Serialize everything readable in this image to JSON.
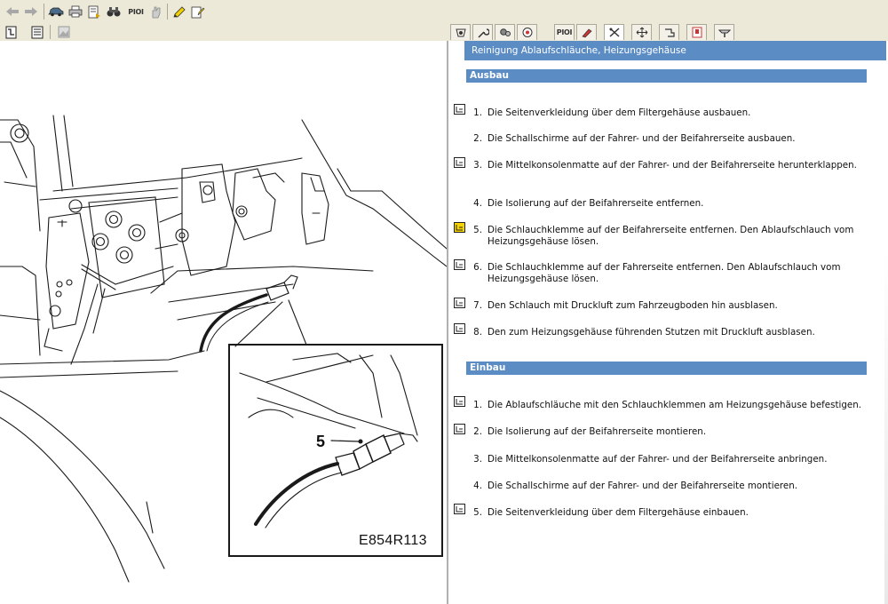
{
  "toolbar": {
    "pioi_label": "PIOI"
  },
  "tabs": {
    "pioi_label": "PIOI"
  },
  "illustration": {
    "callout_number": "5",
    "figure_code": "E854R113"
  },
  "document": {
    "title": "Reinigung Ablaufschläuche, Heizungsgehäuse",
    "sections": [
      {
        "heading": "Ausbau",
        "steps": [
          {
            "num": "1.",
            "text": "Die Seitenverkleidung über dem Filtergehäuse ausbauen."
          },
          {
            "num": "2.",
            "text": "Die Schallschirme auf der Fahrer- und der Beifahrerseite ausbauen."
          },
          {
            "num": "3.",
            "text": "Die Mittelkonsolenmatte auf der Fahrer- und der Beifahrerseite herunterklappen."
          },
          {
            "num": "4.",
            "text": "Die Isolierung auf der Beifahrerseite entfernen."
          },
          {
            "num": "5.",
            "text": "Die Schlauchklemme auf der Beifahrerseite entfernen. Den Ablaufschlauch vom Heizungsgehäuse lösen."
          },
          {
            "num": "6.",
            "text": "Die Schlauchklemme auf der Fahrerseite entfernen. Den Ablaufschlauch vom Heizungsgehäuse lösen."
          },
          {
            "num": "7.",
            "text": "Den Schlauch mit Druckluft zum Fahrzeugboden hin ausblasen."
          },
          {
            "num": "8.",
            "text": "Den zum Heizungsgehäuse führenden Stutzen mit Druckluft ausblasen."
          }
        ]
      },
      {
        "heading": "Einbau",
        "steps": [
          {
            "num": "1.",
            "text": "Die Ablaufschläuche mit den Schlauchklemmen am Heizungsgehäuse befestigen."
          },
          {
            "num": "2.",
            "text": "Die Isolierung auf der Beifahrerseite montieren."
          },
          {
            "num": "3.",
            "text": "Die Mittelkonsolenmatte auf der Fahrer- und der Beifahrerseite anbringen."
          },
          {
            "num": "4.",
            "text": "Die Schallschirme auf der Fahrer- und der Beifahrerseite montieren."
          },
          {
            "num": "5.",
            "text": "Die Seitenverkleidung über dem Filtergehäuse einbauen."
          }
        ]
      }
    ]
  },
  "colors": {
    "accent": "#5b8cc4",
    "toolbar_bg": "#ece9d8"
  }
}
